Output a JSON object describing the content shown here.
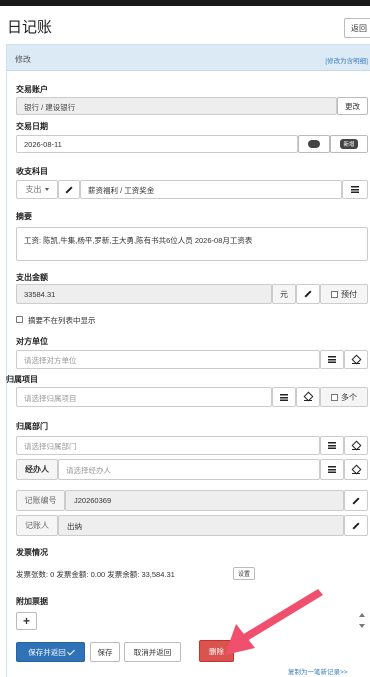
{
  "page_title": "日记账",
  "back_label": "返回",
  "panel": {
    "title": "修改",
    "edit_link": "[修改为含明细]"
  },
  "account": {
    "label": "交易账户",
    "value": "银行 / 建设银行",
    "change_label": "更改"
  },
  "date": {
    "label": "交易日期",
    "value": "2026-08-11",
    "btn2_label": "新增"
  },
  "category": {
    "label": "收支科目",
    "type_label": "支出",
    "value": "薪资福利 / 工资奖金"
  },
  "summary": {
    "label": "摘要",
    "value": "工资: 陈凯,牛集,杨平,罗新,王大勇,陈有书共6位人员 2026-08月工资表"
  },
  "amount": {
    "label": "支出金额",
    "value": "33584.31",
    "unit": "元",
    "prepay_label": "预付"
  },
  "hide_summary_label": "摘要不在列表中显示",
  "counterparty": {
    "label": "对方单位",
    "placeholder": "请选择对方单位"
  },
  "project": {
    "label": "归属项目",
    "placeholder": "请选择归属项目",
    "multi_label": "多个"
  },
  "department": {
    "label": "归属部门",
    "placeholder": "请选择归属部门"
  },
  "handler": {
    "label": "经办人",
    "placeholder": "请选择经办人"
  },
  "voucher": {
    "label": "记账编号",
    "value": "J20260369"
  },
  "bookkeeper": {
    "label": "记账人",
    "value": "出纳"
  },
  "invoice": {
    "label": "发票情况",
    "summary": "发票张数: 0  发票金额: 0.00  发票余额: 33,584.31",
    "set_label": "设置"
  },
  "attachments": {
    "label": "附加票据",
    "add_symbol": "+"
  },
  "actions": {
    "save_back": "保存并返回",
    "save": "保存",
    "cancel_back": "取消并返回",
    "delete": "删除"
  },
  "copy_link": "复制为一笔新记录>>",
  "colors": {
    "primary": "#2f72b8",
    "danger": "#d9534f",
    "arrow": "#f0506e",
    "panel_head": "#dceaf6"
  }
}
